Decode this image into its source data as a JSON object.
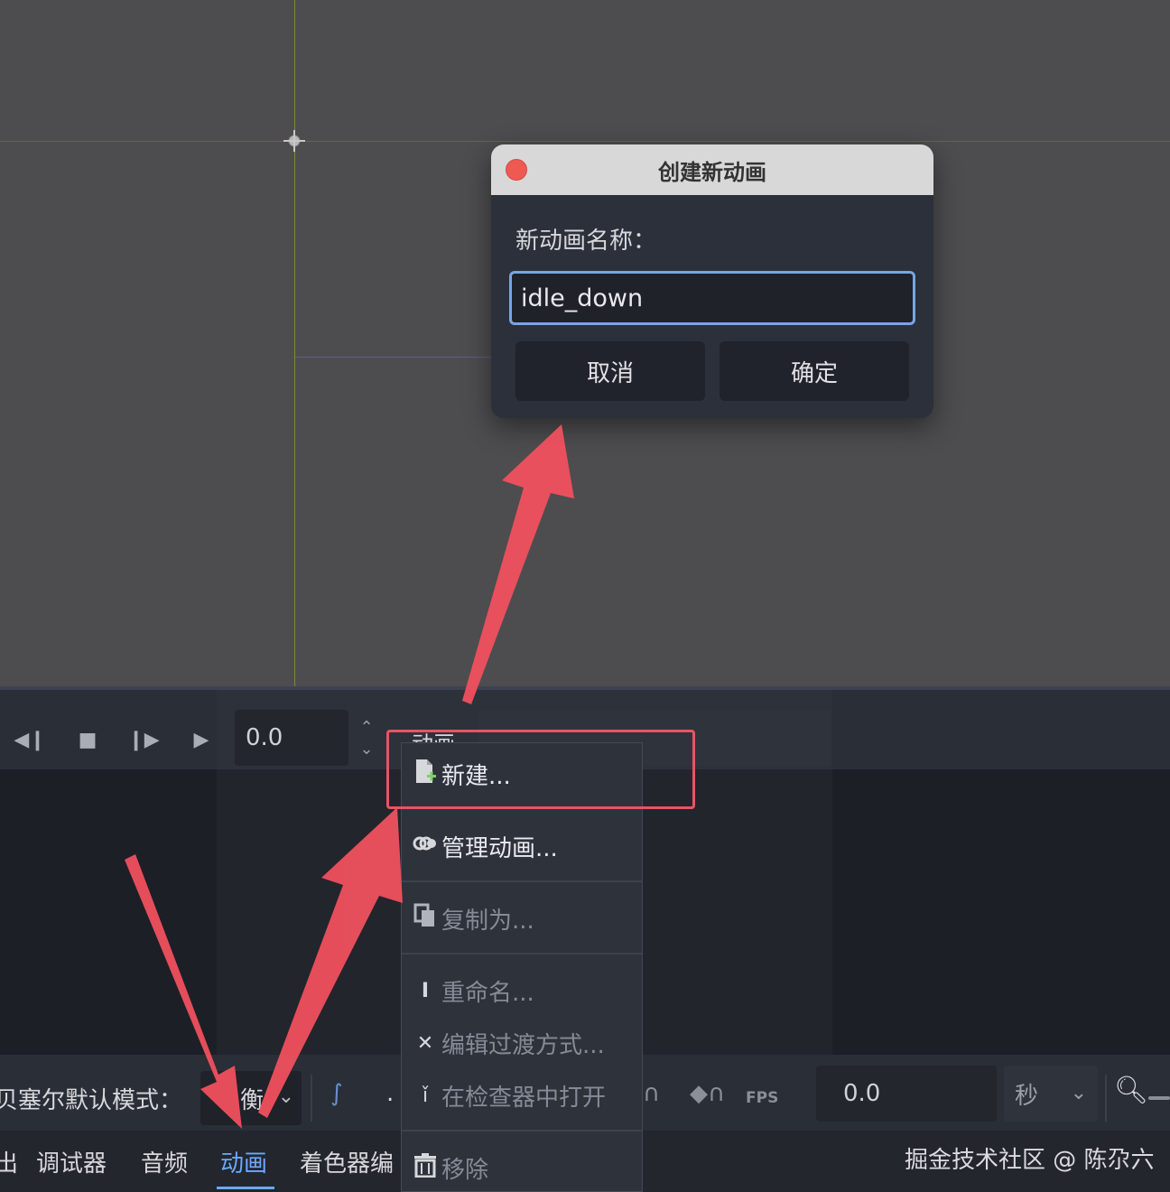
{
  "dialog": {
    "title": "创建新动画",
    "name_label": "新动画名称：",
    "name_value": "idle_down",
    "cancel_label": "取消",
    "confirm_label": "确定"
  },
  "anim_toolbar": {
    "time_value": "0.0",
    "animation_label": "动画"
  },
  "menu": {
    "items": [
      {
        "label": "新建...",
        "icon": "new-file-icon",
        "enabled": true
      },
      {
        "label": "管理动画...",
        "icon": "manage-animations-icon",
        "enabled": true
      },
      {
        "label": "复制为...",
        "icon": "duplicate-icon",
        "enabled": false
      },
      {
        "label": "重命名...",
        "icon": "rename-icon",
        "enabled": false
      },
      {
        "label": "编辑过渡方式...",
        "icon": "blend-icon",
        "enabled": false
      },
      {
        "label": "在检查器中打开",
        "icon": "inspector-icon",
        "enabled": false
      },
      {
        "label": "移除",
        "icon": "trash-icon",
        "enabled": false
      }
    ]
  },
  "bottom_toolbar": {
    "bezier_mode_label": "贝塞尔默认模式：",
    "balance_value": "衡",
    "fps_label": "FPS",
    "snap_value": "0.0",
    "unit_value": "秒"
  },
  "bottom_tabs": {
    "items": [
      "出",
      "调试器",
      "音频",
      "动画",
      "着色器编"
    ],
    "active": "动画"
  },
  "watermark": "掘金技术社区 @ 陈尕六",
  "colors": {
    "accent": "#6aa9ff",
    "annotation_red": "#e85560",
    "panel_bg": "#1f2229"
  }
}
